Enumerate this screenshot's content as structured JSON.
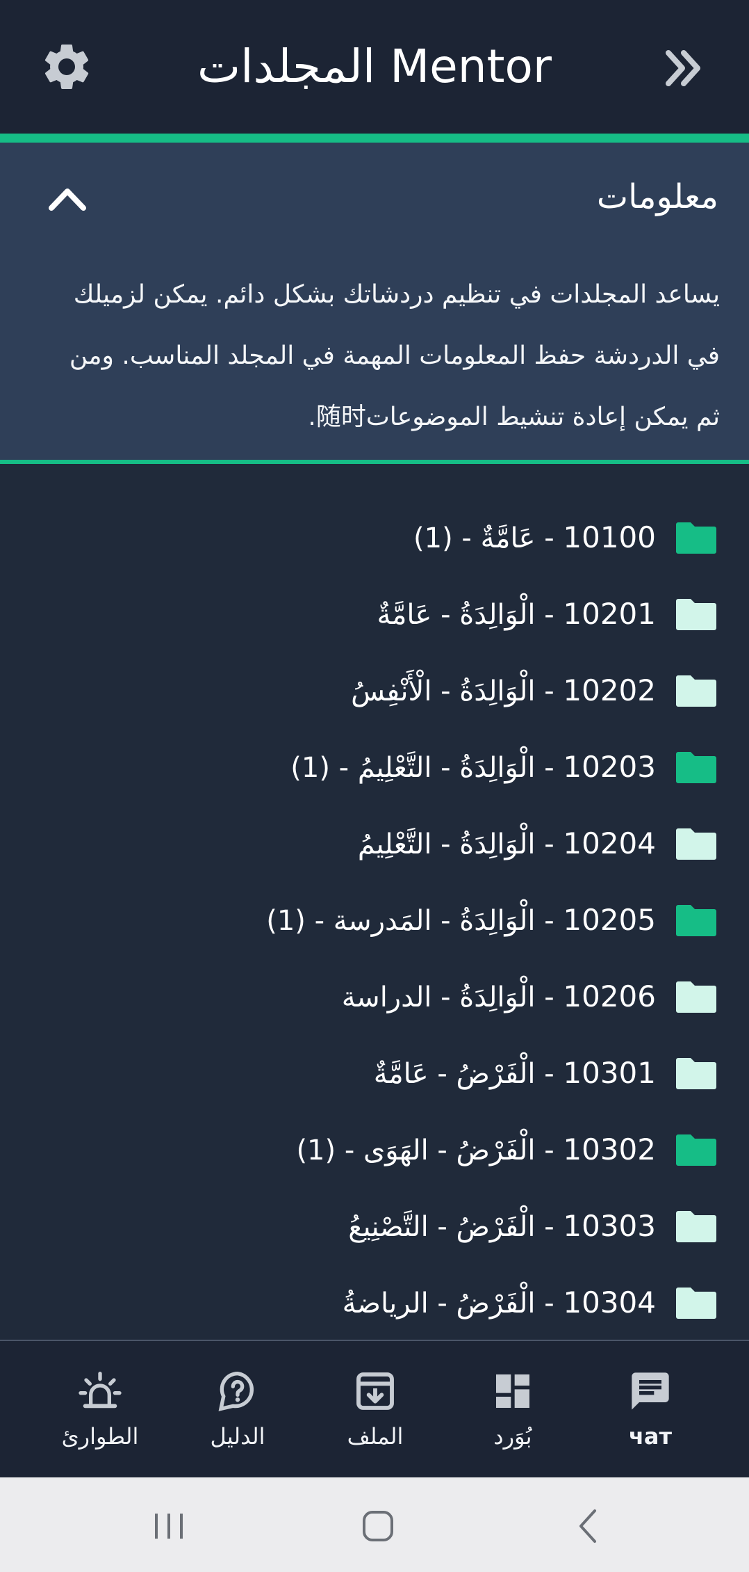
{
  "header": {
    "title": "Mentor المجلدات",
    "settings_icon": "gear-icon",
    "forward_icon": "double-chevron-right-icon"
  },
  "info": {
    "heading": "معلومات",
    "body": "يساعد المجلدات في تنظيم دردشاتك بشكل دائم. يمكن لزميلك في الدردشة حفظ المعلومات المهمة في المجلد المناسب. ومن ثم يمكن إعادة تنشيط الموضوعات随时."
  },
  "folders": [
    {
      "code": "10100",
      "name": "عَامَّةٌ - (1)",
      "has_items": true
    },
    {
      "code": "10201",
      "name": "الْوَالِدَةُ - عَامَّةٌ",
      "has_items": false
    },
    {
      "code": "10202",
      "name": "الْوَالِدَةُ - الْأَنْفِسُ",
      "has_items": false
    },
    {
      "code": "10203",
      "name": "الْوَالِدَةُ - التَّعْلِيمُ - (1)",
      "has_items": true
    },
    {
      "code": "10204",
      "name": "الْوَالِدَةُ - التَّعْلِيمُ",
      "has_items": false
    },
    {
      "code": "10205",
      "name": "الْوَالِدَةُ - المَدرسة - (1)",
      "has_items": true
    },
    {
      "code": "10206",
      "name": "الْوَالِدَةُ - الدراسة",
      "has_items": false
    },
    {
      "code": "10301",
      "name": "الْفَرْضُ - عَامَّةٌ",
      "has_items": false
    },
    {
      "code": "10302",
      "name": "الْفَرْضُ - الهَوَى - (1)",
      "has_items": true
    },
    {
      "code": "10303",
      "name": "الْفَرْضُ - التَّصْنِيعُ",
      "has_items": false
    },
    {
      "code": "10304",
      "name": "الْفَرْضُ - الرياضةُ",
      "has_items": false
    }
  ],
  "nav": {
    "items": [
      {
        "label": "чат",
        "icon": "chat-icon",
        "active": true
      },
      {
        "label": "بُوَرد",
        "icon": "dashboard-icon",
        "active": false
      },
      {
        "label": "الملف",
        "icon": "archive-icon",
        "active": false
      },
      {
        "label": "الدليل",
        "icon": "help-icon",
        "active": false
      },
      {
        "label": "الطوارئ",
        "icon": "siren-icon",
        "active": false
      }
    ]
  },
  "colors": {
    "accent": "#16bd86",
    "folder_filled": "#16bd86",
    "folder_empty": "#d2f5ea",
    "background": "#202a3a",
    "header_bg": "#1c2434",
    "info_bg": "#2f3f58"
  }
}
